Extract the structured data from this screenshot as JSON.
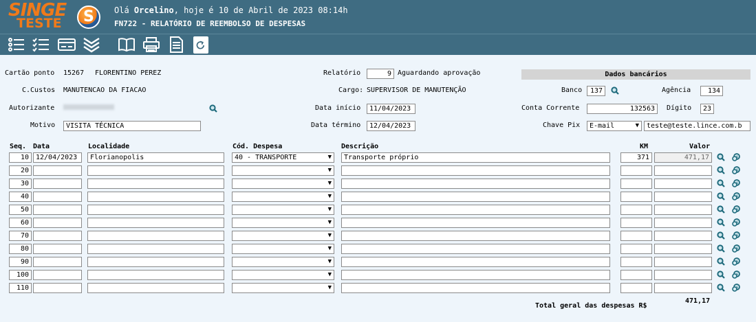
{
  "header": {
    "logo_top": "SINGE",
    "logo_bottom": "TESTE",
    "logo_mark": "S",
    "greeting_prefix": "Olá ",
    "user": "Orcelino",
    "greeting_suffix": ", hoje é 10 de Abril de 2023 08:14h",
    "title": "FN722 - RELATÓRIO DE REEMBOLSO DE DESPESAS"
  },
  "toolbar": {
    "icons": [
      "list-icon",
      "checklist-icon",
      "card-icon",
      "chevrons-down-icon",
      "book-icon",
      "printer-icon",
      "document-icon",
      "refresh-icon"
    ]
  },
  "form": {
    "cartao_label": "Cartão ponto",
    "cartao_num": "15267",
    "cartao_name": "FLORENTINO PEREZ",
    "ccustos_label": "C.Custos",
    "ccustos_value": "MANUTENCAO DA FIACAO",
    "autorizante_label": "Autorizante",
    "motivo_label": "Motivo",
    "motivo_value": "VISITA TÉCNICA",
    "relatorio_label": "Relatório",
    "relatorio_value": "9",
    "relatorio_status": "Aguardando aprovação",
    "cargo_label": "Cargo:",
    "cargo_value": "SUPERVISOR DE MANUTENÇÃO",
    "data_inicio_label": "Data início",
    "data_inicio_value": "11/04/2023",
    "data_termino_label": "Data término",
    "data_termino_value": "12/04/2023"
  },
  "bank": {
    "header": "Dados bancários",
    "banco_label": "Banco",
    "banco_value": "137",
    "agencia_label": "Agência",
    "agencia_value": "134",
    "conta_label": "Conta Corrente",
    "conta_value": "132563",
    "digito_label": "Dígito",
    "digito_value": "23",
    "pix_label": "Chave Pix",
    "pix_type": "E-mail",
    "pix_value": "teste@teste.lince.com.b"
  },
  "table": {
    "headers": {
      "seq": "Seq.",
      "data": "Data",
      "localidade": "Localidade",
      "cod": "Cód. Despesa",
      "descricao": "Descrição",
      "km": "KM",
      "valor": "Valor"
    },
    "rows": [
      {
        "seq": "10",
        "data": "12/04/2023",
        "localidade": "Florianopolis",
        "cod": "40 - TRANSPORTE",
        "descricao": "Transporte próprio",
        "km": "371",
        "valor": "471,17"
      },
      {
        "seq": "20",
        "data": "",
        "localidade": "",
        "cod": "",
        "descricao": "",
        "km": "",
        "valor": ""
      },
      {
        "seq": "30",
        "data": "",
        "localidade": "",
        "cod": "",
        "descricao": "",
        "km": "",
        "valor": ""
      },
      {
        "seq": "40",
        "data": "",
        "localidade": "",
        "cod": "",
        "descricao": "",
        "km": "",
        "valor": ""
      },
      {
        "seq": "50",
        "data": "",
        "localidade": "",
        "cod": "",
        "descricao": "",
        "km": "",
        "valor": ""
      },
      {
        "seq": "60",
        "data": "",
        "localidade": "",
        "cod": "",
        "descricao": "",
        "km": "",
        "valor": ""
      },
      {
        "seq": "70",
        "data": "",
        "localidade": "",
        "cod": "",
        "descricao": "",
        "km": "",
        "valor": ""
      },
      {
        "seq": "80",
        "data": "",
        "localidade": "",
        "cod": "",
        "descricao": "",
        "km": "",
        "valor": ""
      },
      {
        "seq": "90",
        "data": "",
        "localidade": "",
        "cod": "",
        "descricao": "",
        "km": "",
        "valor": ""
      },
      {
        "seq": "100",
        "data": "",
        "localidade": "",
        "cod": "",
        "descricao": "",
        "km": "",
        "valor": ""
      },
      {
        "seq": "110",
        "data": "",
        "localidade": "",
        "cod": "",
        "descricao": "",
        "km": "",
        "valor": ""
      }
    ],
    "total_label": "Total geral das despesas R$",
    "total_value": "471,17"
  }
}
